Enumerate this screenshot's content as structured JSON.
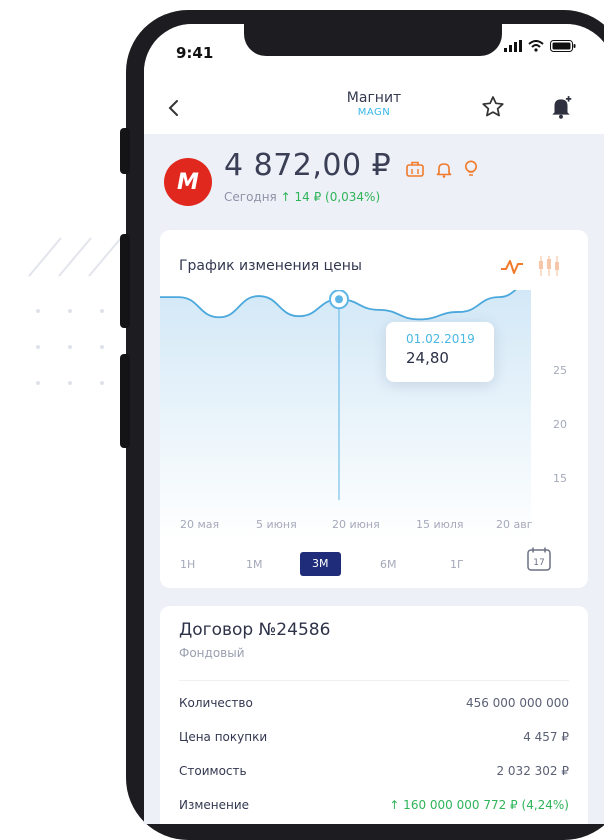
{
  "status_bar": {
    "time": "9:41"
  },
  "nav": {
    "title": "Магнит",
    "ticker": "MAGN"
  },
  "stock": {
    "logo_letter": "M",
    "price": "4 872,00 ₽",
    "today_label": "Сегодня",
    "today_change": "↑ 14 ₽ (0,034%)"
  },
  "chart_card": {
    "title": "График изменения цены",
    "tooltip": {
      "date": "01.02.2019",
      "value": "24,80"
    },
    "periods": [
      "1Н",
      "1М",
      "3М",
      "6М",
      "1Г"
    ],
    "active_period": "3М",
    "calendar_day": "17"
  },
  "chart_data": {
    "type": "line",
    "x": [
      "20 мая",
      "5 июня",
      "20 июня",
      "15 июля",
      "20 авг"
    ],
    "y_ticks": [
      25,
      20,
      15
    ],
    "ylim": [
      12,
      28
    ],
    "series": [
      {
        "x": [
          0,
          0.5,
          1,
          1.5,
          2,
          2.5,
          3,
          3.5,
          4,
          4.4
        ],
        "values": [
          25.0,
          23.1,
          25.1,
          23.2,
          24.8,
          23.8,
          22.9,
          23.6,
          25.0,
          26.3
        ]
      }
    ],
    "highlight": {
      "date": "01.02.2019",
      "value": 24.8
    },
    "colors": {
      "line": "#4aa8dc",
      "fill": "#cfe6f6"
    }
  },
  "contract": {
    "title": "Договор №24586",
    "subtitle": "Фондовый",
    "rows": [
      {
        "label": "Количество",
        "value": "456 000 000 000"
      },
      {
        "label": "Цена покупки",
        "value": "4 457 ₽"
      },
      {
        "label": "Стоимость",
        "value": "2 032 302 ₽"
      },
      {
        "label": "Изменение",
        "value": "↑ 160 000 000 772 ₽ (4,24%)"
      }
    ]
  },
  "colors": {
    "accent": "#1f2c7a",
    "brand": "#e0281e",
    "positive": "#2fb45a",
    "orange": "#f07a2b"
  }
}
